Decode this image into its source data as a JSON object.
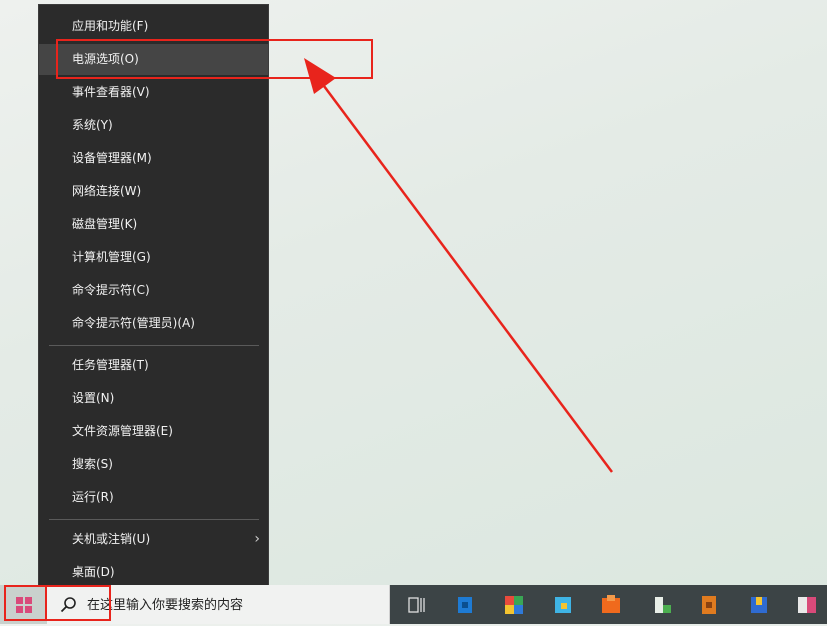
{
  "context_menu": {
    "items": [
      {
        "label": "应用和功能(F)"
      },
      {
        "label": "电源选项(O)"
      },
      {
        "label": "事件查看器(V)"
      },
      {
        "label": "系统(Y)"
      },
      {
        "label": "设备管理器(M)"
      },
      {
        "label": "网络连接(W)"
      },
      {
        "label": "磁盘管理(K)"
      },
      {
        "label": "计算机管理(G)"
      },
      {
        "label": "命令提示符(C)"
      },
      {
        "label": "命令提示符(管理员)(A)"
      },
      {
        "label": "任务管理器(T)"
      },
      {
        "label": "设置(N)"
      },
      {
        "label": "文件资源管理器(E)"
      },
      {
        "label": "搜索(S)"
      },
      {
        "label": "运行(R)"
      },
      {
        "label": "关机或注销(U)"
      },
      {
        "label": "桌面(D)"
      }
    ],
    "highlighted_item": "电源选项(O)",
    "submenu_arrow_icon": "chevron-right-icon"
  },
  "taskbar": {
    "start_icon": "windows-logo-icon",
    "search_placeholder": "在这里输入你要搜索的内容",
    "taskview_icon": "task-view-icon"
  },
  "annotations": {
    "color": "#e8241c"
  },
  "colors": {
    "menu_background": "#2b2b2b",
    "menu_highlight": "#454545",
    "menu_text": "#f2f2f2",
    "win_logo": "#d94a7a"
  }
}
